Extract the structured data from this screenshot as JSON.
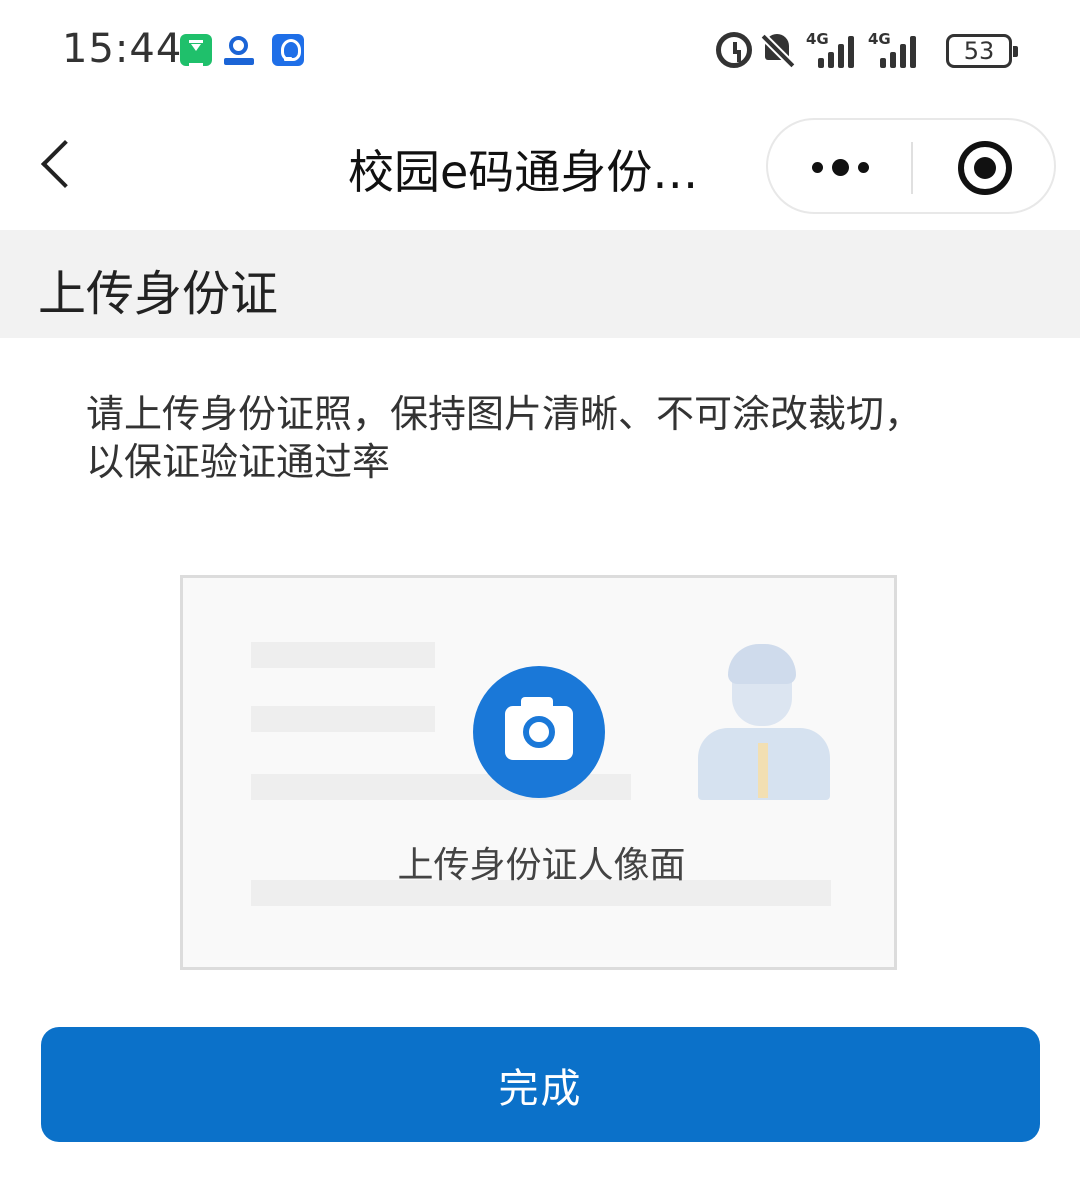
{
  "status_bar": {
    "time": "15:44",
    "network_1": "4G",
    "network_2": "4G",
    "battery": "53",
    "app_icons": [
      "hourglass-icon",
      "campus-app-icon",
      "lightbulb-icon"
    ],
    "system_icons": [
      "alarm-icon",
      "bell-off-icon",
      "signal-icon",
      "signal-icon",
      "battery-icon"
    ]
  },
  "nav": {
    "title": "校园e码通身份…",
    "back_icon": "chevron-left-icon",
    "more_icon": "more-dots-icon",
    "close_icon": "target-circle-icon"
  },
  "section": {
    "title": "上传身份证"
  },
  "instruction": "请上传身份证照，保持图片清晰、不可涂改裁切，以保证验证通过率",
  "upload": {
    "label": "上传身份证人像面",
    "icon": "camera-icon"
  },
  "done_button": "完成",
  "colors": {
    "accent": "#0b71c9",
    "camera": "#1a78d8",
    "section_bg": "#f2f2f2"
  }
}
